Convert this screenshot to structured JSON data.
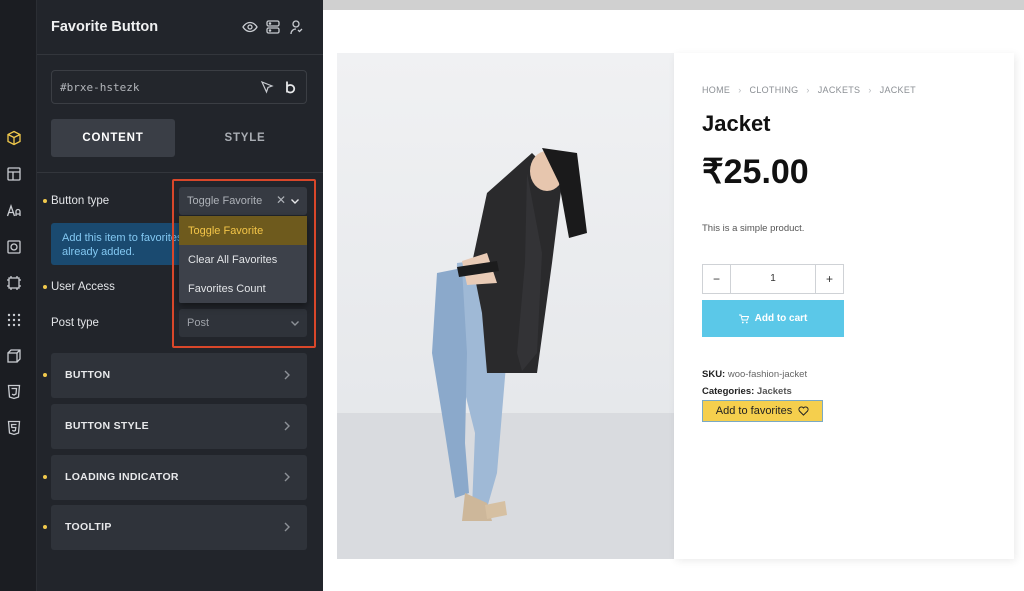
{
  "panel": {
    "title": "Favorite Button",
    "element_id": "#brxe-hstezk",
    "tabs": [
      {
        "label": "CONTENT",
        "active": true
      },
      {
        "label": "STYLE",
        "active": false
      }
    ],
    "controls": {
      "button_type": {
        "label": "Button type",
        "value": "Toggle Favorite"
      },
      "hint_text": "Add this item to favorites or remove if already added.",
      "user_access": {
        "label": "User Access"
      },
      "post_type": {
        "label": "Post type",
        "value": "Post"
      }
    },
    "dropdown_options": [
      "Toggle Favorite",
      "Clear All Favorites",
      "Favorites Count"
    ],
    "sections": [
      "BUTTON",
      "BUTTON STYLE",
      "LOADING INDICATOR",
      "TOOLTIP"
    ]
  },
  "rail_icons": [
    "cube-icon",
    "layout-icon",
    "typography-icon",
    "component-icon",
    "frame-icon",
    "grid-icon",
    "box3d-icon",
    "css3-icon",
    "html5-icon"
  ],
  "product": {
    "breadcrumb": [
      "HOME",
      "CLOTHING",
      "JACKETS",
      "JACKET"
    ],
    "title": "Jacket",
    "price": "₹25.00",
    "description": "This is a simple product.",
    "quantity": "1",
    "add_to_cart": "Add to cart",
    "sku_label": "SKU:",
    "sku_value": "woo-fashion-jacket",
    "categories_label": "Categories:",
    "categories_value": "Jackets",
    "favorites_button": "Add to favorites"
  },
  "colors": {
    "accent_yellow": "#f5cf4d",
    "cart_blue": "#5bc8e8",
    "highlight_red": "#d9472a",
    "panel_bg": "#22252b"
  }
}
